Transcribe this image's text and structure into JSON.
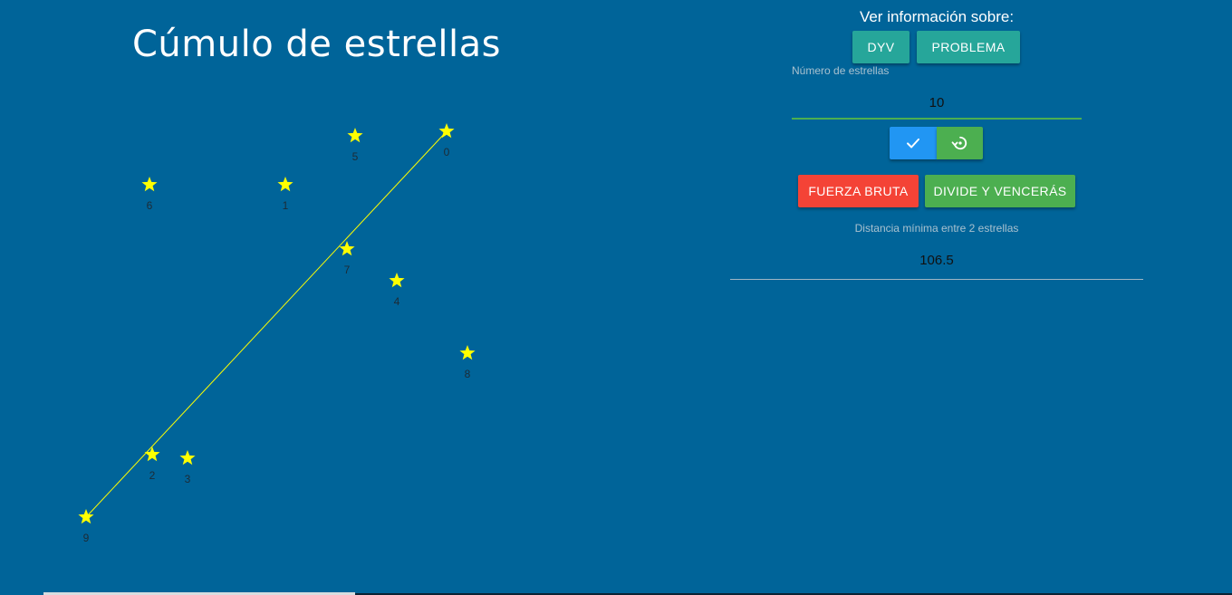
{
  "title": "Cúmulo de estrellas",
  "info": {
    "heading": "Ver información sobre:",
    "dyv_button": "DYV",
    "problema_button": "PROBLEMA"
  },
  "stars_input": {
    "label": "Número de estrellas",
    "value": "10"
  },
  "icons": {
    "confirm": "check-icon",
    "reset": "restore-icon"
  },
  "actions": {
    "brute_force": "FUERZA BRUTA",
    "divide_conquer": "DIVIDE Y VENCERÁS"
  },
  "result": {
    "label": "Distancia mínima entre 2 estrellas",
    "value": "106.5"
  },
  "stars": [
    {
      "id": "0"
    },
    {
      "id": "1"
    },
    {
      "id": "2"
    },
    {
      "id": "3"
    },
    {
      "id": "4"
    },
    {
      "id": "5"
    },
    {
      "id": "6"
    },
    {
      "id": "7"
    },
    {
      "id": "8"
    },
    {
      "id": "9"
    }
  ],
  "highlighted_pair": [
    "0",
    "9"
  ],
  "colors": {
    "background": "#006499",
    "star": "#ffff00",
    "line": "#ffff00",
    "teal": "#26a69a",
    "red": "#f44336",
    "green": "#4caf50",
    "blue": "#2196f3"
  }
}
